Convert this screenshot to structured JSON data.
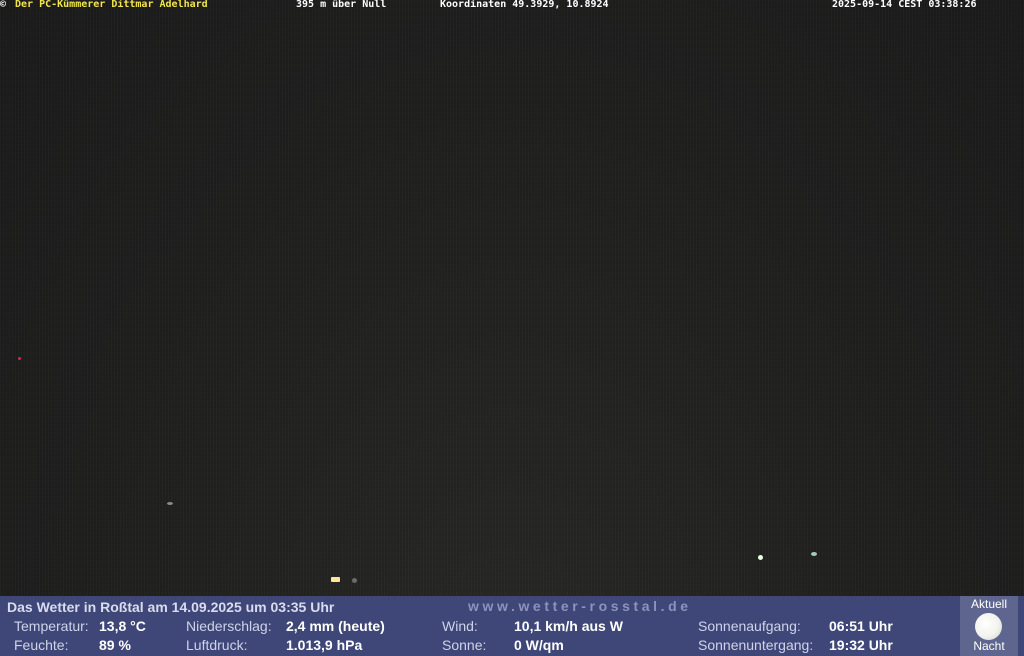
{
  "header": {
    "copyright_symbol": "©",
    "owner": "Der PC-Kümmerer Dittmar Adelhard",
    "altitude": "395 m über Null",
    "coordinates": "Koordinaten 49.3929, 10.8924",
    "timestamp": "2025-09-14 CEST 03:38:26"
  },
  "panel": {
    "title": "Das Wetter in Roßtal am 14.09.2025 um 03:35 Uhr",
    "website": "www.wetter-rosstal.de",
    "labels": {
      "temperatur": "Temperatur:",
      "feuchte": "Feuchte:",
      "niederschlag": "Niederschlag:",
      "luftdruck": "Luftdruck:",
      "wind": "Wind:",
      "sonne": "Sonne:",
      "sonnenaufgang": "Sonnenaufgang:",
      "sonnenuntergang": "Sonnenuntergang:"
    },
    "values": {
      "temperatur": "13,8 °C",
      "feuchte": "89 %",
      "niederschlag": "2,4 mm (heute)",
      "luftdruck": "1.013,9 hPa",
      "wind": "10,1 km/h aus W",
      "sonne": "0 W/qm",
      "sonnenaufgang": "06:51 Uhr",
      "sonnenuntergang": "19:32 Uhr"
    },
    "moon": {
      "top_label": "Aktuell",
      "bottom_label": "Nacht",
      "icon": "moon-icon"
    }
  },
  "colors": {
    "panel_background": "#3e4778",
    "header_owner": "#f2e64b",
    "header_text": "#ffffff"
  }
}
